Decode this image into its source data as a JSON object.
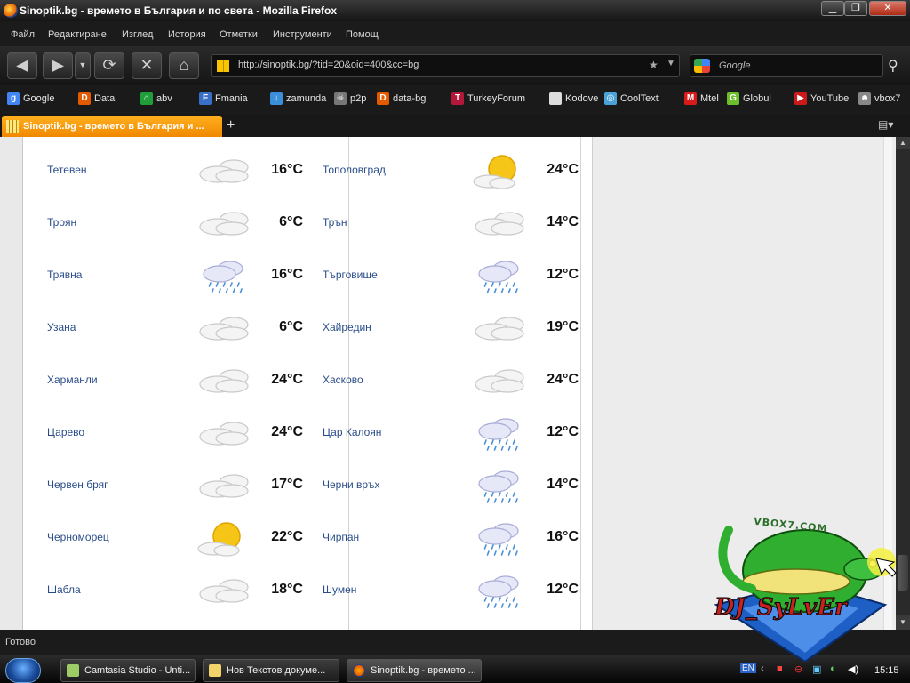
{
  "window": {
    "title": "Sinoptik.bg - времето в България и по света - Mozilla Firefox",
    "buttons": {
      "minimize": "▁",
      "maximize": "❐",
      "close": "✕"
    }
  },
  "menu": [
    "Файл",
    "Редактиране",
    "Изглед",
    "История",
    "Отметки",
    "Инструменти",
    "Помощ"
  ],
  "nav": {
    "url": "http://sinoptik.bg/?tid=20&oid=400&cc=bg",
    "search_placeholder": "Google"
  },
  "bookmarks": [
    {
      "label": "Google",
      "icon": "google-icon",
      "color": "#4285f4",
      "glyph": "g"
    },
    {
      "label": "Data",
      "icon": "data-icon",
      "color": "#e35a00",
      "glyph": "D"
    },
    {
      "label": "abv",
      "icon": "home-icon",
      "color": "#1f9e3a",
      "glyph": "⌂"
    },
    {
      "label": "Fmania",
      "icon": "fmania-icon",
      "color": "#3a6fc8",
      "glyph": "F"
    },
    {
      "label": "zamunda",
      "icon": "zamunda-icon",
      "color": "#3b8fd8",
      "glyph": "↓"
    },
    {
      "label": "p2p",
      "icon": "skull-icon",
      "color": "#777777",
      "glyph": "☠"
    },
    {
      "label": "data-bg",
      "icon": "data-bg-icon",
      "color": "#e35a00",
      "glyph": "D"
    },
    {
      "label": "TurkeyForum",
      "icon": "turkeyforum-icon",
      "color": "#b3183a",
      "glyph": "T"
    },
    {
      "label": "Kodove",
      "icon": "page-icon",
      "color": "#dddddd",
      "glyph": ""
    },
    {
      "label": "CoolText",
      "icon": "cooltext-icon",
      "color": "#4aa3d8",
      "glyph": "◎"
    },
    {
      "label": "Mtel",
      "icon": "mtel-icon",
      "color": "#d81a1a",
      "glyph": "M"
    },
    {
      "label": "Globul",
      "icon": "globul-icon",
      "color": "#6abf2a",
      "glyph": "G"
    },
    {
      "label": "YouTube",
      "icon": "youtube-icon",
      "color": "#cc1a1a",
      "glyph": "▶"
    },
    {
      "label": "vbox7",
      "icon": "vbox7-icon",
      "color": "#888888",
      "glyph": "☻"
    }
  ],
  "tab": {
    "label": "Sinoptik.bg - времето в България и ...",
    "new_tab": "+"
  },
  "weather": {
    "left": [
      {
        "city": "Тетевен",
        "temp": "16°C",
        "icon": "cloudy"
      },
      {
        "city": "Троян",
        "temp": "6°C",
        "icon": "cloudy"
      },
      {
        "city": "Трявна",
        "temp": "16°C",
        "icon": "rain"
      },
      {
        "city": "Узана",
        "temp": "6°C",
        "icon": "cloudy"
      },
      {
        "city": "Харманли",
        "temp": "24°C",
        "icon": "cloudy"
      },
      {
        "city": "Царево",
        "temp": "24°C",
        "icon": "cloudy"
      },
      {
        "city": "Червен бряг",
        "temp": "17°C",
        "icon": "cloudy"
      },
      {
        "city": "Черноморец",
        "temp": "22°C",
        "icon": "sunny"
      },
      {
        "city": "Шабла",
        "temp": "18°C",
        "icon": "cloudy"
      }
    ],
    "right": [
      {
        "city": "Тополовград",
        "temp": "24°C",
        "icon": "sunny"
      },
      {
        "city": "Трън",
        "temp": "14°C",
        "icon": "cloudy"
      },
      {
        "city": "Търговище",
        "temp": "12°C",
        "icon": "rain"
      },
      {
        "city": "Хайредин",
        "temp": "19°C",
        "icon": "cloudy"
      },
      {
        "city": "Хасково",
        "temp": "24°C",
        "icon": "cloudy"
      },
      {
        "city": "Цар Калоян",
        "temp": "12°C",
        "icon": "rain"
      },
      {
        "city": "Черни връх",
        "temp": "14°C",
        "icon": "rain"
      },
      {
        "city": "Чирпан",
        "temp": "16°C",
        "icon": "rain"
      },
      {
        "city": "Шумен",
        "temp": "12°C",
        "icon": "rain"
      }
    ]
  },
  "status": "Готово",
  "taskbar": {
    "tasks": [
      {
        "label": "Camtasia Studio - Unti...",
        "icon": "camtasia-icon"
      },
      {
        "label": "Нов Текстов докуме...",
        "icon": "notepad-icon"
      },
      {
        "label": "Sinoptik.bg - времето ...",
        "icon": "firefox-icon"
      }
    ],
    "lang": "EN",
    "clock": "15:15"
  },
  "overlay": {
    "site": "VBOX7.COM",
    "name": "DJ_SyLvEr"
  }
}
